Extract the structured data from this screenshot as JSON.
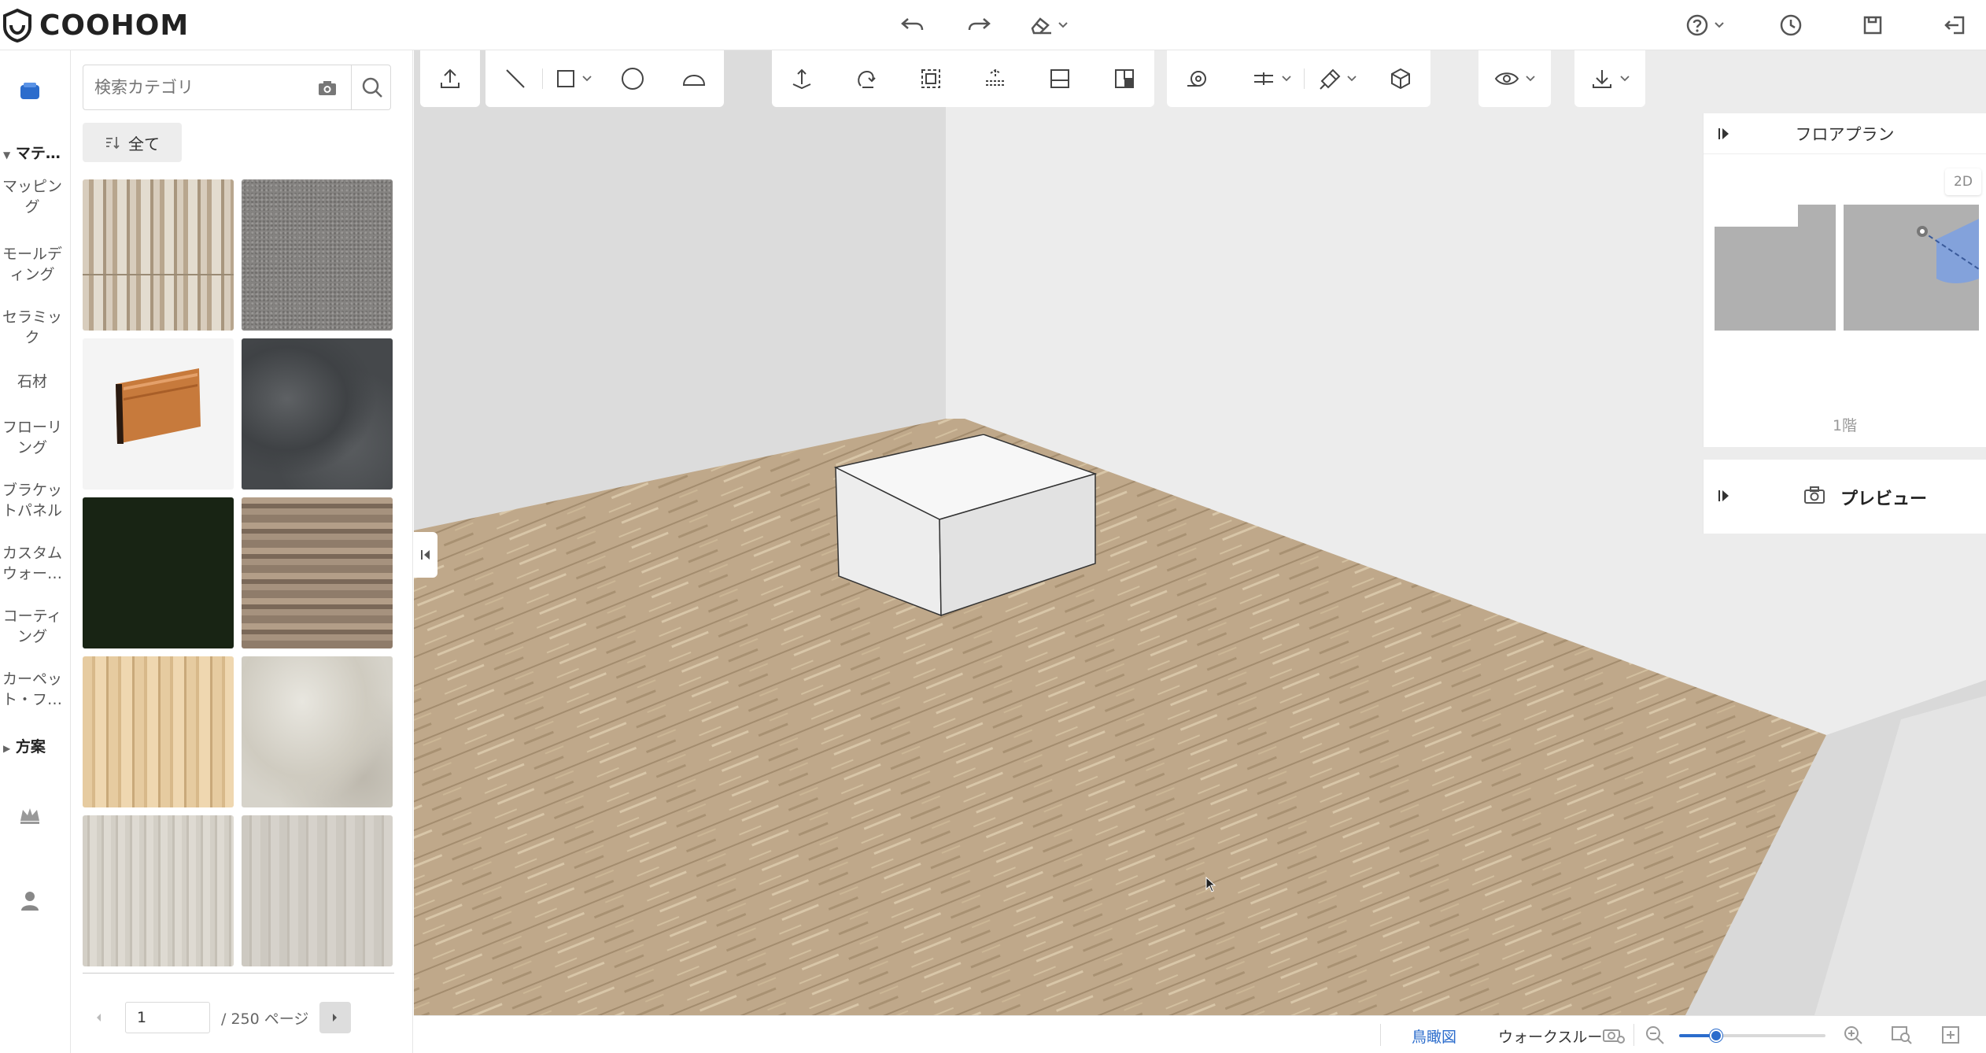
{
  "app": {
    "logo_text": "COOHOM"
  },
  "topbar": {
    "center_icons": [
      "undo-icon",
      "redo-icon",
      "eraser-icon"
    ],
    "right_icons": [
      "help-icon",
      "history-icon",
      "save-icon",
      "exit-icon"
    ]
  },
  "left_rail": {
    "groups": [
      {
        "label": "マテ…",
        "expanded": true
      },
      {
        "label": "方案",
        "expanded": false
      }
    ],
    "items": [
      "マッピング",
      "モールディング",
      "セラミック",
      "石材",
      "フローリング",
      "ブラケットパネル",
      "カスタムウォー…",
      "コーティング",
      "カーペット・フ…"
    ],
    "bottom_icons": [
      "crown-icon",
      "user-icon"
    ]
  },
  "material_panel": {
    "search_placeholder": "検索カテゴリ",
    "filter_label": "全て",
    "tiles": [
      {
        "name": "weathered-wood-light",
        "color": "#c9b8a0"
      },
      {
        "name": "grey-carpet",
        "color": "#8a8886"
      },
      {
        "name": "wood-moulding",
        "color": "#c77a3c"
      },
      {
        "name": "dark-grey-stone",
        "color": "#4d5053"
      },
      {
        "name": "black-green",
        "color": "#182414"
      },
      {
        "name": "brown-wood-planks",
        "color": "#8f7c6a"
      },
      {
        "name": "light-pine-wood",
        "color": "#e6cba0"
      },
      {
        "name": "white-marble",
        "color": "#d6d3ca"
      },
      {
        "name": "pale-wood-grain",
        "color": "#d3cfc6"
      },
      {
        "name": "light-grey-wood",
        "color": "#cdc9c1"
      }
    ],
    "pager": {
      "current_page": "1",
      "total_label": "/ 250 ページ"
    }
  },
  "toolbar": {
    "groups": [
      [
        "upload-icon"
      ],
      [
        "line-icon",
        "rectangle-icon",
        "circle-icon",
        "arc-icon"
      ],
      [
        "extrude-icon",
        "rotate-icon",
        "select-region-icon",
        "align-icon",
        "split-icon",
        "pattern-icon"
      ],
      [
        "measure-icon",
        "dimension-icon",
        "paint-icon",
        "solid-icon"
      ],
      [
        "view-icon"
      ],
      [
        "download-icon"
      ]
    ]
  },
  "floor_plan": {
    "title": "フロアプラン",
    "mode_badge": "2D",
    "floor_label": "1階"
  },
  "preview": {
    "title": "プレビュー"
  },
  "statusbar": {
    "tab_bird": "鳥瞰図",
    "tab_walk": "ウォークスルー",
    "zoom_level": 0.25
  },
  "colors": {
    "accent": "#2b6ccc",
    "floor": "#bfa88a",
    "wall": "#dcdcdc",
    "box": "#f2f2f2"
  }
}
